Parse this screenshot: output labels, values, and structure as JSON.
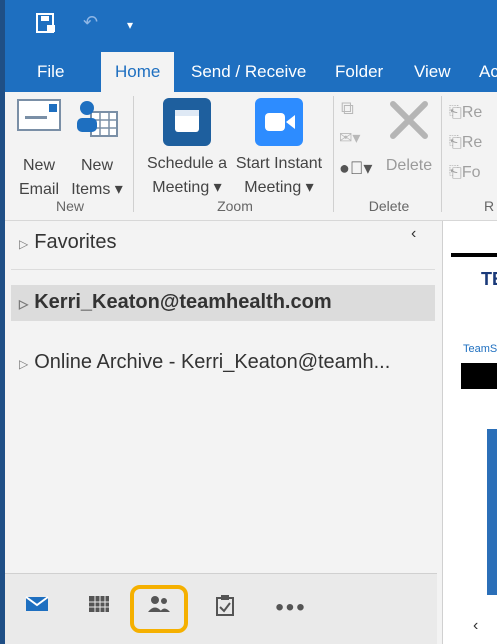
{
  "tabs": [
    "File",
    "Home",
    "Send / Receive",
    "Folder",
    "View",
    "Ac"
  ],
  "ribbon": {
    "new_email": [
      "New",
      "Email"
    ],
    "new_items": [
      "New",
      "Items ▾"
    ],
    "schedule": [
      "Schedule a",
      "Meeting ▾"
    ],
    "start_instant": [
      "Start Instant",
      "Meeting ▾"
    ],
    "delete": "Delete",
    "reply_items": [
      "Re",
      "Re",
      "Fo"
    ],
    "groups": [
      "New",
      "Zoom",
      "Delete",
      "R"
    ]
  },
  "folders": {
    "favorites": "Favorites",
    "account": "Kerri_Keaton@teamhealth.com",
    "archive": "Online Archive - Kerri_Keaton@teamh..."
  },
  "reading": {
    "brand": "TE",
    "sub": "TeamS"
  },
  "colors": {
    "accent": "#1e6fc0",
    "highlight": "#f5b000",
    "zoom": "#2d8cff"
  }
}
